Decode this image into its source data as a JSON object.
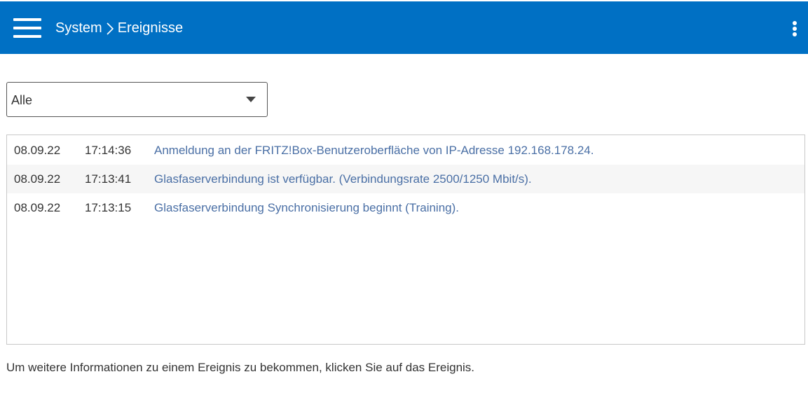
{
  "header": {
    "breadcrumb": [
      "System",
      "Ereignisse"
    ],
    "background_color": "#0070c4"
  },
  "filter": {
    "selected": "Alle"
  },
  "events": [
    {
      "date": "08.09.22",
      "time": "17:14:36",
      "message": "Anmeldung an der FRITZ!Box-Benutzeroberfläche von IP-Adresse 192.168.178.24."
    },
    {
      "date": "08.09.22",
      "time": "17:13:41",
      "message": "Glasfaserverbindung ist verfügbar. (Verbindungsrate 2500/1250 Mbit/s)."
    },
    {
      "date": "08.09.22",
      "time": "17:13:15",
      "message": "Glasfaserverbindung Synchronisierung beginnt (Training)."
    }
  ],
  "hint": "Um weitere Informationen zu einem Ereignis zu bekommen, klicken Sie auf das Ereignis.",
  "link_color": "#4a6fa5"
}
